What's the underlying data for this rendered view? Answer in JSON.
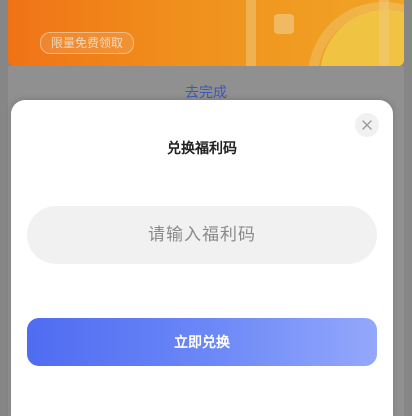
{
  "background": {
    "promo_pill": "限量免费领取",
    "link": "去完成"
  },
  "dialog": {
    "title": "兑换福利码",
    "close_icon": "close-icon",
    "input_placeholder": "请输入福利码",
    "input_value": "",
    "submit_label": "立即兑换"
  },
  "colors": {
    "banner_orange": "#ff8a1e",
    "link_blue": "#3f5fbf",
    "button_gradient_start": "#4f6cf2",
    "button_gradient_end": "#93a8fb",
    "input_bg": "#f1f1f1"
  }
}
